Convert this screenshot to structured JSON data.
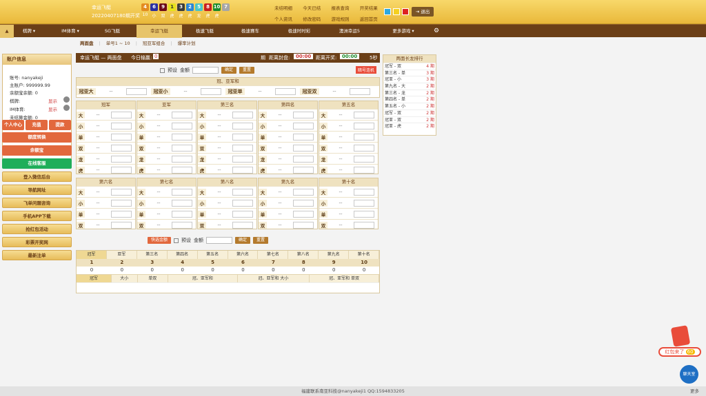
{
  "header": {
    "game_title": "幸运飞艇",
    "period": "20220407180期开奖",
    "balls": [
      {
        "n": "4",
        "c": "#e38b20"
      },
      {
        "n": "6",
        "c": "#2b2fa0"
      },
      {
        "n": "9",
        "c": "#6c0a18"
      },
      {
        "n": "1",
        "c": "#e6e21a"
      },
      {
        "n": "3",
        "c": "#3b3b3b"
      },
      {
        "n": "2",
        "c": "#2b86d6"
      },
      {
        "n": "5",
        "c": "#4ac6c8"
      },
      {
        "n": "8",
        "c": "#c81f1f"
      },
      {
        "n": "10",
        "c": "#1a8a2a"
      },
      {
        "n": "7",
        "c": "#a6a6a6"
      }
    ],
    "ball_labels": [
      "10",
      "小",
      "双",
      "虎",
      "虎",
      "虎",
      "龙",
      "虎",
      "虎"
    ],
    "links": [
      "未结明细",
      "今天已结",
      "报表查询",
      "开奖结果",
      "个人资讯",
      "修改密码",
      "游戏规则",
      "返回首页"
    ],
    "logout": "退出"
  },
  "nav": {
    "items": [
      "棋牌",
      "IM体育",
      "SG飞艇",
      "幸运飞艇",
      "极速飞艇",
      "极速赛车",
      "极速时时彩",
      "澳洲幸运5",
      "更多游戏"
    ]
  },
  "subnav": {
    "items": [
      "两面盘",
      "单号1 ~ 10",
      "冠亚军组合",
      "爆率计划"
    ]
  },
  "account": {
    "title": "账户信息",
    "username": "账号: nanyakeji",
    "main_account": "主账户: 999999.99",
    "balance": "余额宝余额: 0",
    "qipai": "棋牌:",
    "qipai_status": "显示",
    "im": "IM体育:",
    "im_status": "显示",
    "unsettled": "未结算金额: 0",
    "mini_buttons": [
      "个人中心",
      "充值",
      "提款"
    ],
    "buttons": [
      "额度转换",
      "余额宝",
      "在线客服",
      "登入微信后台",
      "导航网址",
      "飞单问题咨询",
      "手机APP下载",
      "抢红包活动",
      "彩票开奖网",
      "最新注单"
    ]
  },
  "betpanel": {
    "title": "幸运飞艇 — 两面盘",
    "today": "今日输赢:",
    "today_val": "0",
    "countdown_close_label": "距离封盘:",
    "countdown_close": "00:00",
    "countdown_open_label": "距离开奖:",
    "countdown_open": "00:00",
    "seconds": "5秒",
    "yushe": "预设",
    "amount": "金额",
    "confirm": "确定",
    "reset": "重置",
    "autoplay": "暗号连机",
    "top_header": "冠、亚军和",
    "top_items": [
      "冠亚大",
      "冠亚小",
      "冠亚单",
      "冠亚双"
    ],
    "group1": [
      "冠军",
      "亚军",
      "第三名",
      "第四名",
      "第五名"
    ],
    "group2": [
      "第六名",
      "第七名",
      "第八名",
      "第九名",
      "第十名"
    ],
    "rows": [
      "大",
      "小",
      "单",
      "双",
      "龙",
      "虎"
    ],
    "rows2": [
      "大",
      "小",
      "单",
      "双"
    ],
    "quick": "快选金额",
    "dash": "--"
  },
  "stats": {
    "tabs": [
      "冠军",
      "亚军",
      "第三名",
      "第四名",
      "第五名",
      "第六名",
      "第七名",
      "第八名",
      "第九名",
      "第十名"
    ],
    "nums": [
      "1",
      "2",
      "3",
      "4",
      "5",
      "6",
      "7",
      "8",
      "9",
      "10"
    ],
    "vals": [
      "0",
      "0",
      "0",
      "0",
      "0",
      "0",
      "0",
      "0",
      "0",
      "0"
    ],
    "sub": [
      "冠军",
      "大小",
      "单双",
      "冠、亚军和",
      "冠、亚军和 大小",
      "冠、亚军和 单双"
    ]
  },
  "longdragon": {
    "title": "两面长龙排行",
    "rows": [
      {
        "n": "冠军 - 双",
        "v": "4 期"
      },
      {
        "n": "第三名 - 单",
        "v": "3 期"
      },
      {
        "n": "冠亚 - 小",
        "v": "3 期"
      },
      {
        "n": "第九名 - 大",
        "v": "2 期"
      },
      {
        "n": "第三名 - 龙",
        "v": "2 期"
      },
      {
        "n": "第四名 - 单",
        "v": "2 期"
      },
      {
        "n": "第五名 - 小",
        "v": "2 期"
      },
      {
        "n": "冠军 - 双",
        "v": "2 期"
      },
      {
        "n": "冠亚 - 双",
        "v": "2 期"
      },
      {
        "n": "冠亚 - 虎",
        "v": "2 期"
      }
    ]
  },
  "footer": "福建联系南亚科技@nanyakeji1 QQ:1594833205",
  "footer_more": "更多",
  "redpack": "红包来了",
  "redpack_n": "60",
  "chat": "聊天室"
}
